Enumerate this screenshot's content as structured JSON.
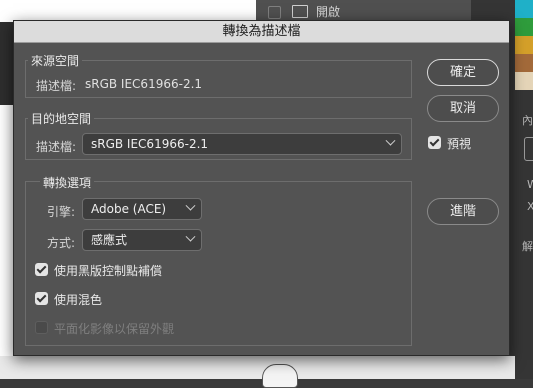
{
  "background": {
    "layer_label": "開啟",
    "swatch_colors": [
      "#1fb0c8",
      "#2f9c3c",
      "#d4a02a",
      "#a36a3a",
      "#e5d5b8"
    ],
    "right_panel_fragments": [
      "內",
      "W",
      "X",
      "解"
    ]
  },
  "dialog": {
    "title": "轉換為描述檔",
    "source_space": {
      "title": "來源空間",
      "profile_label": "描述檔:",
      "profile_value": "sRGB IEC61966-2.1"
    },
    "destination_space": {
      "title": "目的地空間",
      "profile_label": "描述檔:",
      "profile_value": "sRGB IEC61966-2.1"
    },
    "conversion_options": {
      "title": "轉換選項",
      "engine_label": "引擎:",
      "engine_value": "Adobe (ACE)",
      "intent_label": "方式:",
      "intent_value": "感應式",
      "black_point_label": "使用黑版控制點補償",
      "black_point_checked": true,
      "dither_label": "使用混色",
      "dither_checked": true,
      "flatten_label": "平面化影像以保留外觀",
      "flatten_checked": false,
      "flatten_disabled": true
    },
    "buttons": {
      "ok": "確定",
      "cancel": "取消",
      "advanced": "進階"
    },
    "preview": {
      "label": "預視",
      "checked": true
    }
  }
}
